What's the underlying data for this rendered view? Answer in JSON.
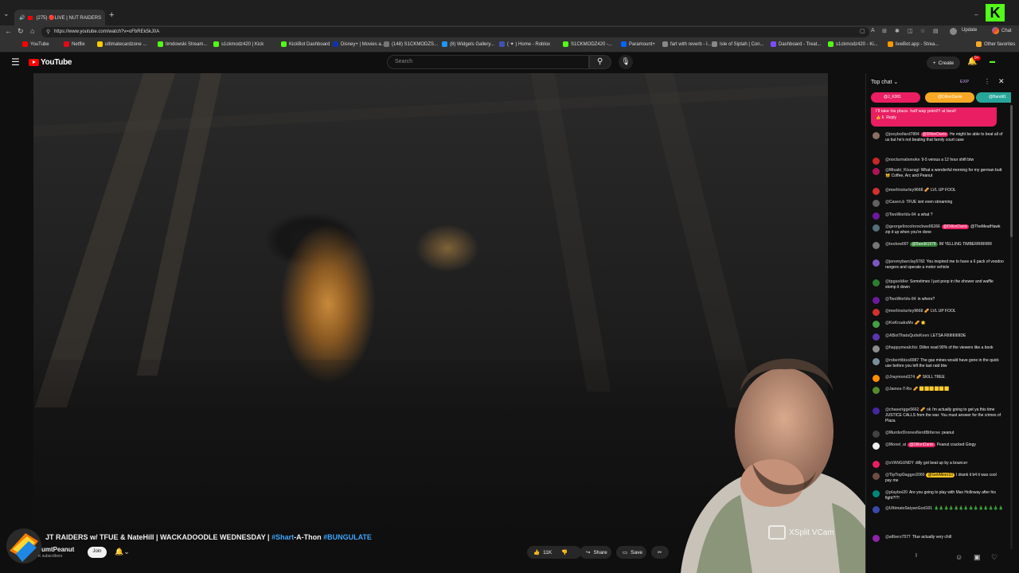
{
  "browser": {
    "tab_title": "(275) 🔴LIVE | NUT RAIDERS",
    "url": "https://www.youtube.com/watch?v=oFbREk5kJ0A",
    "update_label": "Update",
    "chat_label": "Chat",
    "bookmarks": [
      "YouTube",
      "Netflix",
      "ultimatecardzone ...",
      "timdowski Stream...",
      "s1ckmodz420 | Kick",
      "KickBot Dashboard",
      "Disney+ | Movies a...",
      "(148) S1CKMODZS...",
      "(8) Widgets Gallery...",
      "( ✦ ) Home - Roblox",
      "S1CKMODZ420 -...",
      "Paramount+",
      "fart with reverb - I...",
      "Isle of Siptah | Con...",
      "Dashboard - Treat...",
      "s1ckmodz420 - Ki...",
      "liveBot.app - Strea...",
      "Other favorites"
    ]
  },
  "youtube": {
    "logo_text": "YouTube",
    "search_placeholder": "Search",
    "create_label": "Create",
    "notif_count": "9+"
  },
  "video": {
    "title_main": "JT RAIDERS w/ TFUE & NateHill | WACKADOODLE WEDNESDAY | ",
    "title_tag1": "#Shart",
    "title_mid": "-A-Thon ",
    "title_tag2": "#BUNGULATE",
    "channel": "umtPeanut",
    "subs": "K subscribers",
    "join": "Join",
    "likes": "11K",
    "share": "Share",
    "save": "Save",
    "webcam_watermark": "XSplit VCam"
  },
  "chat": {
    "header": "Top chat",
    "exp": "EXP",
    "tickers": [
      {
        "name": "@J_K001",
        "color": "#e91e63"
      },
      {
        "name": "@DillonDanis",
        "color": "#f9a825"
      },
      {
        "name": "@Bandit1",
        "color": "#26a69a"
      }
    ],
    "pinned_text": "I'll take his place. half way point!!! at best!",
    "pinned_likes": "6",
    "pinned_reply": "Reply",
    "messages": [
      {
        "author": "@joeybollard7894",
        "mention": "@DillonDanis",
        "mtype": "mn",
        "text": "He might be able to beat all of us but he's not beating that family court case",
        "avatar": "#8d6e63"
      },
      {
        "author": "@nocturnalsmoke",
        "text": "9-5 versus a 12 hour shift btw",
        "avatar": "#c62828"
      },
      {
        "author": "@Misaki_Kisaragi",
        "text": "What a wonderful morning for my german butt 😺 Coffee, Arc and Peanut",
        "avatar": "#ad1457"
      },
      {
        "author": "@merlinsturley9668",
        "text": "🥜 LVL UP FOOL",
        "avatar": "#d32f2f"
      },
      {
        "author": "@Casen.b",
        "text": "TFUE isnt even streaming",
        "avatar": "#616161"
      },
      {
        "author": "@TwoWorlds-94",
        "text": "a what ?",
        "avatar": "#6a1b9a"
      },
      {
        "author": "@georgelincolnrockwell6266",
        "mention": "@DillonDanis",
        "mtype": "mn",
        "text": "@TheMeatHawk zip it up when you're done",
        "avatar": "#546e7a"
      },
      {
        "author": "@toolow007",
        "mention": "@Bandit1978",
        "mtype": "mng",
        "text": "IM YELLING TIMBERRRRRR",
        "avatar": "#757575"
      },
      {
        "author": "@jeremybarclay5782",
        "text": "You inspired me to have a 6 pack of voodoo rangers and operate a motor vehicle",
        "avatar": "#7e57c2"
      },
      {
        "author": "@tpgsoldier",
        "text": "Sometimes I just poop in the shower and waffle stomp it down",
        "avatar": "#2e7d32"
      },
      {
        "author": "@TwoWorlds-94",
        "text": "in where?",
        "avatar": "#6a1b9a"
      },
      {
        "author": "@merlinsturley9668",
        "text": "🥜 LVL UP FOOL",
        "avatar": "#d32f2f"
      },
      {
        "author": "@KoKrsaksMs",
        "text": "🥜 🌟",
        "avatar": "#43a047"
      },
      {
        "author": "@ABotThatsQuiteKeen",
        "text": "LETSA RIIIIIIIIIIIIDE",
        "avatar": "#5e35b1"
      },
      {
        "author": "@happymealchiz",
        "text": "Dillon read 90% of the viewers like a book",
        "avatar": "#8d8d8d"
      },
      {
        "author": "@roberttbiss6087",
        "text": "The gas mines would have gone in the quick use before you left the last raid btw",
        "avatar": "#78909c"
      },
      {
        "author": "@Jraymond174",
        "text": "🥜 SKILL TREE",
        "avatar": "#ff8f00"
      },
      {
        "author": "@James-T-Ro",
        "text": "🥜 🟨🟨🟨🟨🟨🟨",
        "avatar": "#558b2f"
      },
      {
        "author": "@chaserigge5662",
        "text": "🥜 ok i'm actually going to get ya this time JUSTICE CALLS from the war. You must answer for the crimes of Plaza",
        "avatar": "#4527a0"
      },
      {
        "author": "@MurderDronesNerdBitterse",
        "text": "peanut",
        "avatar": "#424242"
      },
      {
        "author": "@Monel_ai",
        "mention": "@DillonDanis",
        "mtype": "mn",
        "text": "Peanut cracked Gingy",
        "avatar": "#eeeeee"
      },
      {
        "author": "@xVANGUNDY",
        "text": "dilly got beat up by a bouncer",
        "avatar": "#e91e63"
      },
      {
        "author": "@TipTopDagger2000",
        "mention": "@GetAlleer10",
        "mtype": "mny",
        "text": "I drank it b4 it was cool pay me",
        "avatar": "#6d4c41"
      },
      {
        "author": "@playboi20",
        "text": "Are you going to play with Max Holloway after his fight?!?!",
        "avatar": "#00897b"
      },
      {
        "author": "@UltimateSaiyanGod101",
        "text": "🎄🎄🎄🎄🎄🎄🎄🎄🎄🎄🎄🎄🎄🎄",
        "avatar": "#3949ab"
      },
      {
        "author": "@allberz7577",
        "text": "Tfue actually very chill",
        "avatar": "#8e24aa"
      }
    ]
  },
  "colors": {
    "accent_red": "#ff0000",
    "kick_green": "#53fc18",
    "link_blue": "#3ea6ff"
  }
}
